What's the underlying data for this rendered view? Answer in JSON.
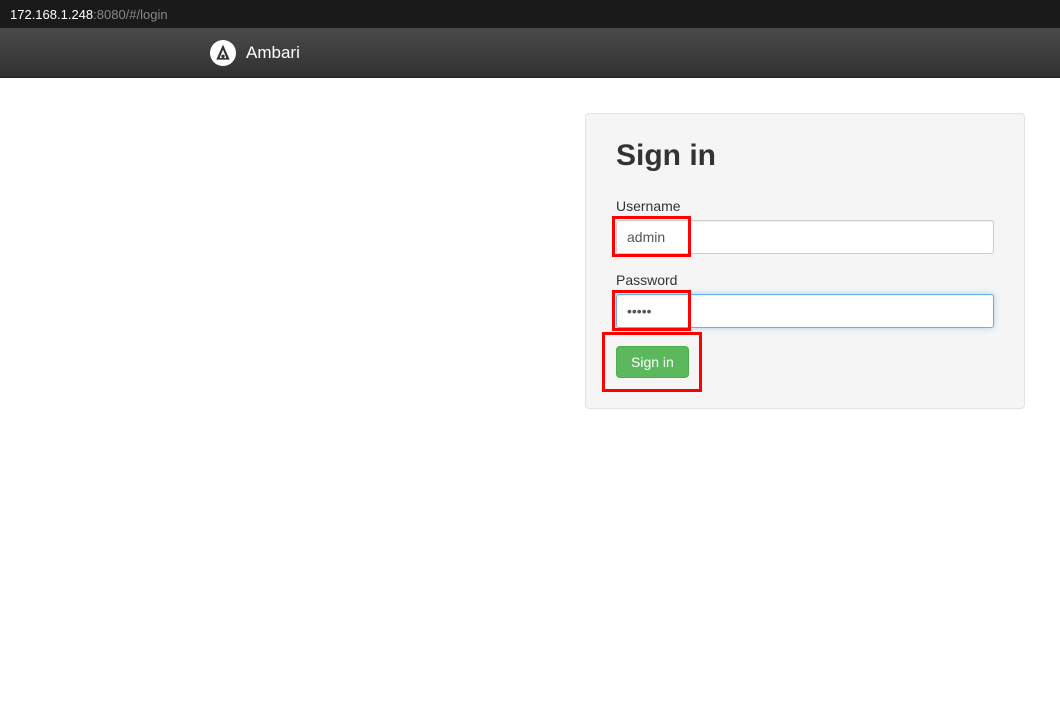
{
  "address": {
    "host": "172.168.1.248",
    "port_path": ":8080/#/login"
  },
  "navbar": {
    "brand": "Ambari"
  },
  "login": {
    "title": "Sign in",
    "username_label": "Username",
    "username_value": "admin",
    "password_label": "Password",
    "password_value": "•••••",
    "signin_button": "Sign in"
  }
}
